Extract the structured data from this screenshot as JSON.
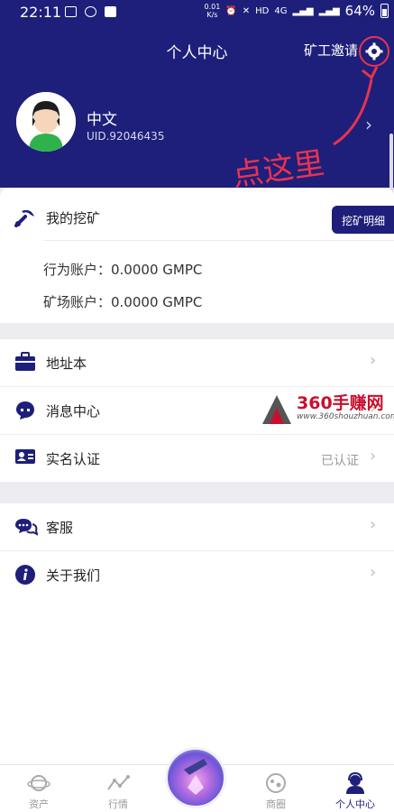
{
  "status_bar": {
    "time": "22:11",
    "speed_value": "0.01",
    "speed_unit": "K/s",
    "net_label": "4G",
    "hd_label": "HD",
    "battery": "64%"
  },
  "header": {
    "title": "个人中心",
    "invite_label": "矿工邀请",
    "background_color": "#1e1f7a",
    "settings_icon": "gear-icon"
  },
  "profile": {
    "name": "中文",
    "uid": "UID.92046435"
  },
  "annotation": {
    "text": "点这里",
    "color": "#e9334f"
  },
  "mining": {
    "title": "我的挖矿",
    "detail_button": "挖矿明细",
    "accounts": [
      {
        "label": "行为账户：0.0000 GMPC"
      },
      {
        "label": "矿场账户：0.0000 GMPC"
      }
    ]
  },
  "menu_group_1": [
    {
      "label": "地址本",
      "icon": "briefcase-icon"
    },
    {
      "label": "消息中心",
      "icon": "chat-bubble-icon"
    },
    {
      "label": "实名认证",
      "icon": "id-card-icon",
      "value": "已认证"
    }
  ],
  "menu_group_2": [
    {
      "label": "客服",
      "icon": "customer-service-icon"
    },
    {
      "label": "关于我们",
      "icon": "info-icon"
    }
  ],
  "watermark": {
    "brand": "360手赚网",
    "url": "www.360shouzhuan.com"
  },
  "tabbar": {
    "tabs": [
      {
        "label": "资产",
        "icon": "planet-icon",
        "active": false
      },
      {
        "label": "行情",
        "icon": "trend-icon",
        "active": false
      },
      {
        "label": "",
        "icon": "mining-orb-icon",
        "active": false
      },
      {
        "label": "商圈",
        "icon": "shop-icon",
        "active": false
      },
      {
        "label": "个人中心",
        "icon": "user-icon",
        "active": true
      }
    ]
  }
}
